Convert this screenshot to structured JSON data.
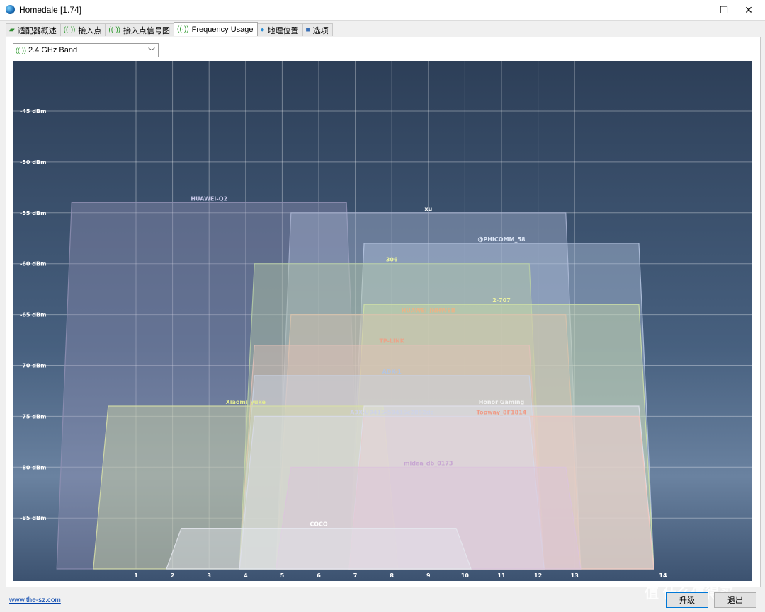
{
  "window": {
    "title": "Homedale [1.74]",
    "minimize": "—",
    "maximize": "☐",
    "close": "✕"
  },
  "tabs": [
    {
      "label": "适配器概述",
      "icon": "adapter-icon"
    },
    {
      "label": "接入点",
      "icon": "wifi-icon"
    },
    {
      "label": "接入点信号图",
      "icon": "wifi-icon"
    },
    {
      "label": "Frequency Usage",
      "icon": "wifi-icon",
      "active": true
    },
    {
      "label": "地理位置",
      "icon": "map-pin-icon"
    },
    {
      "label": "选项",
      "icon": "options-icon"
    }
  ],
  "band_select": {
    "value": "2.4 GHz Band",
    "icon": "wifi-icon"
  },
  "chart_data": {
    "type": "area",
    "x_ticks": [
      "1",
      "2",
      "3",
      "4",
      "5",
      "6",
      "7",
      "8",
      "9",
      "10",
      "11",
      "12",
      "13",
      "14"
    ],
    "y_ticks": [
      "-45 dBm",
      "-50 dBm",
      "-55 dBm",
      "-60 dBm",
      "-65 dBm",
      "-70 dBm",
      "-75 dBm",
      "-80 dBm",
      "-85 dBm"
    ],
    "y_values": [
      -45,
      -50,
      -55,
      -60,
      -65,
      -70,
      -75,
      -80,
      -85
    ],
    "xlim": [
      -2,
      16
    ],
    "ylim": [
      -90,
      -40
    ],
    "series": [
      {
        "name": "HUAWEI-Q2",
        "channel": 3,
        "signal": -54,
        "color": "#8f8fb3",
        "label_color": "#c8c8e8"
      },
      {
        "name": "xu",
        "channel": 9,
        "signal": -55,
        "color": "#aab4d2",
        "label_color": "#ffffff"
      },
      {
        "name": "@PHICOMM_58",
        "channel": 11,
        "signal": -58,
        "color": "#b7c7e3",
        "label_color": "#dde7f7"
      },
      {
        "name": "306",
        "channel": 8,
        "signal": -60,
        "color": "#b9cfa6",
        "label_color": "#e7f1a0"
      },
      {
        "name": "2-707",
        "channel": 11,
        "signal": -64,
        "color": "#cfe0a6",
        "label_color": "#eef3a0"
      },
      {
        "name": "HUAWEI-JNHWEB",
        "channel": 9,
        "signal": -65,
        "color": "#d8c3ad",
        "label_color": "#e6b58a"
      },
      {
        "name": "TP-LINK",
        "channel": 8,
        "signal": -68,
        "color": "#e3c1b8",
        "label_color": "#eaa48a"
      },
      {
        "name": "ADK-1",
        "channel": 8,
        "signal": -71,
        "color": "#c9d4e6",
        "label_color": "#b4c5e0"
      },
      {
        "name": "Xiaomi_yuke",
        "channel": 4,
        "signal": -74,
        "color": "#d9e1a7",
        "label_color": "#e2ea92"
      },
      {
        "name": "Honor Gaming",
        "channel": 11,
        "signal": -74,
        "color": "#e2e2ec",
        "label_color": "#f2f2f2"
      },
      {
        "name": "Topway_8F1814",
        "channel": 11,
        "signal": -75,
        "color": "#f0c6bd",
        "label_color": "#f09a86"
      },
      {
        "name": "A3X-U9415-59415c2852dc",
        "channel": 8,
        "signal": -75,
        "color": "#d8dbe9",
        "label_color": "#cfd3e6"
      },
      {
        "name": "midea_db_0173",
        "channel": 9,
        "signal": -80,
        "color": "#dcc4dc",
        "label_color": "#c7a6d2"
      },
      {
        "name": "COCO",
        "channel": 6,
        "signal": -86,
        "color": "#e5e8ef",
        "label_color": "#ffffff"
      }
    ]
  },
  "footer": {
    "link": "www.the-sz.com",
    "upgrade": "升级",
    "exit": "退出",
    "watermark": "值 什么值得买"
  }
}
